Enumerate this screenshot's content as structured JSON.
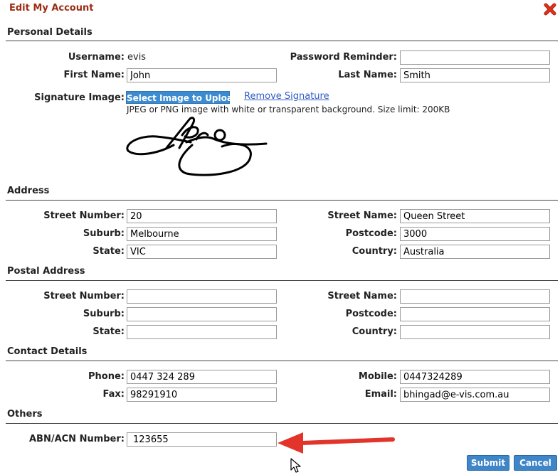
{
  "dialog": {
    "title": "Edit My Account"
  },
  "personal": {
    "heading": "Personal Details",
    "username_label": "Username:",
    "username_value": "evis",
    "password_reminder_label": "Password Reminder:",
    "password_reminder_value": "",
    "first_name_label": "First Name:",
    "first_name_value": "John",
    "last_name_label": "Last Name:",
    "last_name_value": "Smith",
    "signature_label": "Signature Image:",
    "upload_label": "Select Image to Upload",
    "remove_label": "Remove Signature",
    "hint": "JPEG or PNG image with white or transparent background. Size limit: 200KB"
  },
  "address": {
    "heading": "Address",
    "street_number_label": "Street Number:",
    "street_number_value": "20",
    "street_name_label": "Street Name:",
    "street_name_value": "Queen Street",
    "suburb_label": "Suburb:",
    "suburb_value": "Melbourne",
    "postcode_label": "Postcode:",
    "postcode_value": "3000",
    "state_label": "State:",
    "state_value": "VIC",
    "country_label": "Country:",
    "country_value": "Australia"
  },
  "postal": {
    "heading": "Postal Address",
    "street_number_label": "Street Number:",
    "street_number_value": "",
    "street_name_label": "Street Name:",
    "street_name_value": "",
    "suburb_label": "Suburb:",
    "suburb_value": "",
    "postcode_label": "Postcode:",
    "postcode_value": "",
    "state_label": "State:",
    "state_value": "",
    "country_label": "Country:",
    "country_value": ""
  },
  "contact": {
    "heading": "Contact Details",
    "phone_label": "Phone:",
    "phone_value": "0447 324 289",
    "mobile_label": "Mobile:",
    "mobile_value": "0447324289",
    "fax_label": "Fax:",
    "fax_value": "98291910",
    "email_label": "Email:",
    "email_value": "bhingad@e-vis.com.au"
  },
  "others": {
    "heading": "Others",
    "abn_label": "ABN/ACN Number:",
    "abn_value": "123655"
  },
  "actions": {
    "submit_label": "Submit",
    "cancel_label": "Cancel"
  },
  "icons": {
    "close": "close-x-icon",
    "arrow": "red-arrow-icon",
    "cursor": "mouse-cursor-icon"
  },
  "colors": {
    "title": "#9b2c14",
    "button": "#3f86c9",
    "close": "#e0321b",
    "arrow": "#e2342b"
  }
}
